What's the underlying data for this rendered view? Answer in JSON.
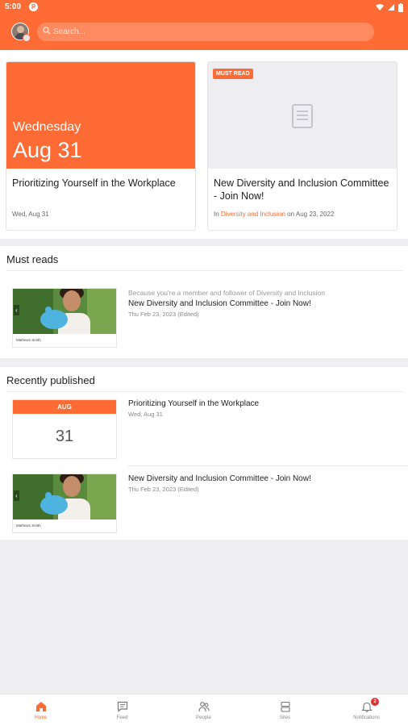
{
  "status_bar": {
    "time": "5:00",
    "app_badge": "P"
  },
  "search": {
    "placeholder": "Search..."
  },
  "featured": [
    {
      "day": "Wednesday",
      "date": "Aug 31",
      "title": "Prioritizing Yourself in the Workplace",
      "meta": "Wed, Aug 31"
    },
    {
      "badge": "MUST READ",
      "title": "New Diversity and Inclusion Committee - Join Now!",
      "meta_prefix": "In ",
      "meta_link": "Diversity and Inclusion",
      "meta_suffix": " on Aug 23, 2022"
    }
  ],
  "must_reads": {
    "heading": "Must reads",
    "items": [
      {
        "reason": "Because you're a member and follower of Diversity and Inclusion",
        "title": "New Diversity and Inclusion Committee - Join Now!",
        "date": "Thu Feb 23, 2023 (Edited)",
        "caption": "Mathews Smith"
      }
    ]
  },
  "recently_published": {
    "heading": "Recently published",
    "items": [
      {
        "month": "AUG",
        "day": "31",
        "title": "Prioritizing Yourself in the Workplace",
        "date": "Wed, Aug 31"
      },
      {
        "title": "New Diversity and Inclusion Committee - Join Now!",
        "date": "Thu Feb 23, 2023 (Edited)",
        "caption": "Mathews Smith"
      }
    ]
  },
  "bottom_nav": [
    {
      "label": "Home",
      "icon": "home-icon",
      "active": true
    },
    {
      "label": "Feed",
      "icon": "feed-icon"
    },
    {
      "label": "People",
      "icon": "people-icon"
    },
    {
      "label": "Sites",
      "icon": "sites-icon"
    },
    {
      "label": "Notifications",
      "icon": "bell-icon",
      "badge": "2"
    }
  ],
  "colors": {
    "accent": "#ff6b35",
    "badge_red": "#e0312f"
  }
}
